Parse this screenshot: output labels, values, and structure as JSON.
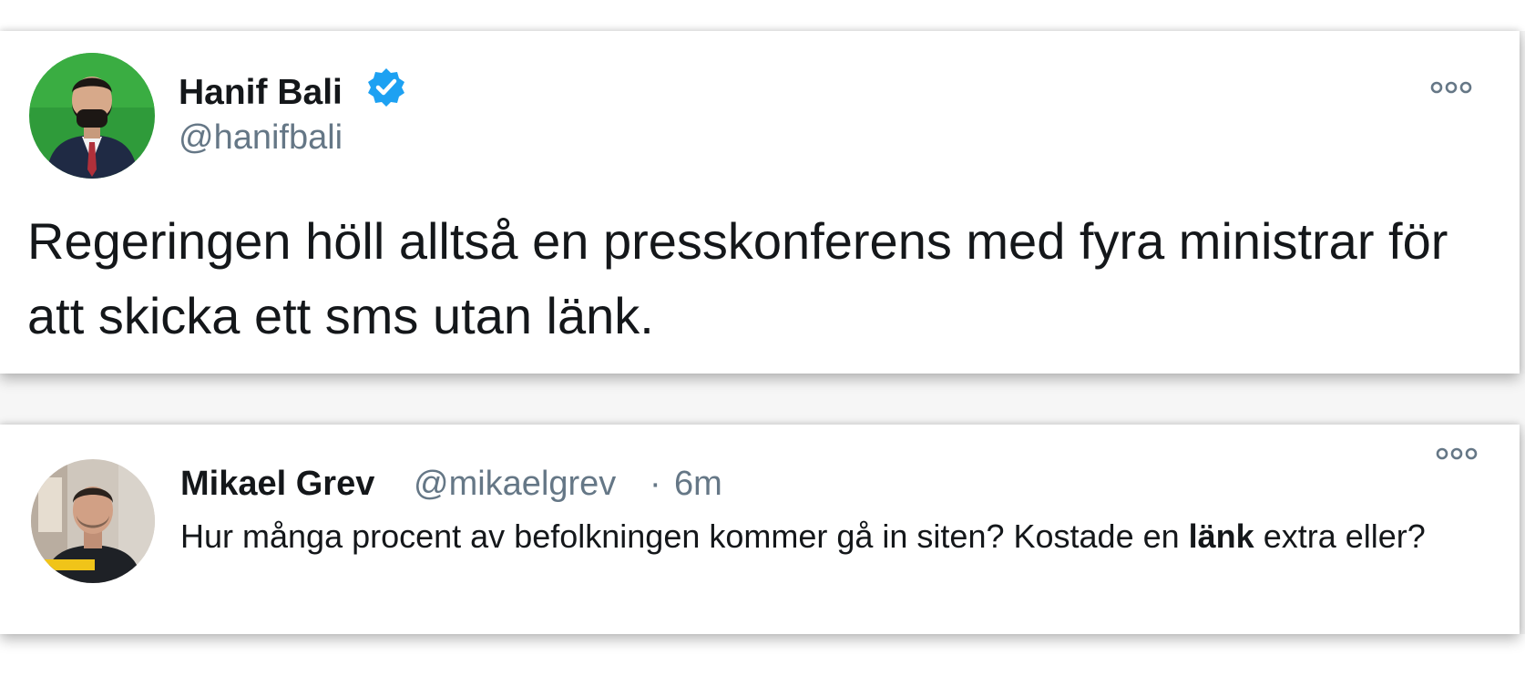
{
  "tweets": [
    {
      "author_name": "Hanif Bali",
      "handle": "@hanifbali",
      "verified": true,
      "text": "Regeringen höll alltså en presskonferens med fyra ministrar för att skicka ett sms utan länk."
    },
    {
      "author_name": "Mikael Grev",
      "handle": "@mikaelgrev",
      "separator": "·",
      "time": "6m",
      "text_before": "Hur många procent av befolkningen kommer gå in siten? Kostade en ",
      "text_bold": "länk",
      "text_after": " extra eller?"
    }
  ],
  "icons": {
    "verified": "verified-badge-icon",
    "more": "more-options-icon"
  },
  "colors": {
    "verified_blue": "#1da1f2",
    "secondary_text": "#657786",
    "primary_text": "#14171a"
  }
}
